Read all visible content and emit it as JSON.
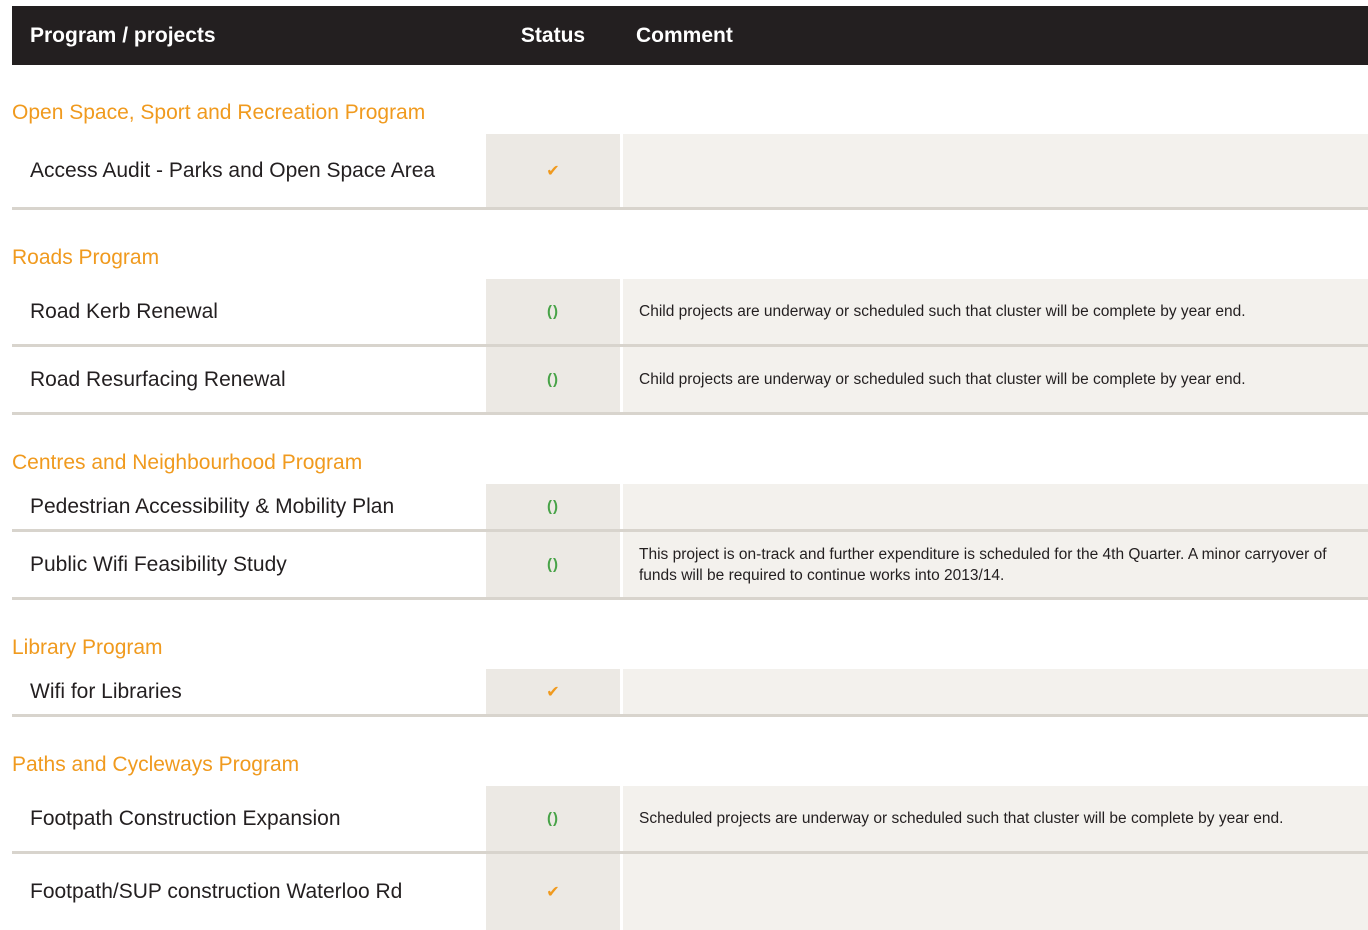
{
  "header": {
    "program_label": "Program / projects",
    "status_label": "Status",
    "comment_label": "Comment"
  },
  "colors": {
    "group_title": "#f09a1e",
    "header_bg": "#231f20",
    "completed_icon": "#f09a1e",
    "in_progress_icon": "#48a348"
  },
  "groups": [
    {
      "title": "Open Space, Sport and Recreation Program",
      "rows": [
        {
          "name": "Access Audit - Parks and Open Space Area",
          "status": "complete-check-icon",
          "status_glyph": "✔",
          "comment": ""
        }
      ]
    },
    {
      "title": "Roads Program",
      "rows": [
        {
          "name": "Road Kerb Renewal",
          "status": "in-progress-icon",
          "status_glyph": "()",
          "comment": "Child projects are underway or scheduled such that cluster will be complete by year end."
        },
        {
          "name": "Road Resurfacing Renewal",
          "status": "in-progress-icon",
          "status_glyph": "()",
          "comment": "Child projects are underway or scheduled such that cluster will be complete by year end."
        }
      ]
    },
    {
      "title": "Centres and Neighbourhood Program",
      "rows": [
        {
          "name": "Pedestrian Accessibility & Mobility Plan",
          "status": "in-progress-icon",
          "status_glyph": "()",
          "comment": ""
        },
        {
          "name": "Public Wifi Feasibility Study",
          "status": "in-progress-icon",
          "status_glyph": "()",
          "comment": "This project is on-track and further expenditure is scheduled for the 4th Quarter. A minor carryover of funds will be required to continue works into 2013/14."
        }
      ]
    },
    {
      "title": "Library Program",
      "rows": [
        {
          "name": "Wifi for Libraries",
          "status": "complete-check-icon",
          "status_glyph": "✔",
          "comment": ""
        }
      ]
    },
    {
      "title": "Paths and Cycleways Program",
      "rows": [
        {
          "name": "Footpath Construction Expansion",
          "status": "in-progress-icon",
          "status_glyph": "()",
          "comment": "Scheduled projects are underway or scheduled such that cluster will be complete by year end."
        },
        {
          "name": "Footpath/SUP construction Waterloo Rd",
          "status": "complete-check-icon",
          "status_glyph": "✔",
          "comment": ""
        }
      ]
    }
  ]
}
